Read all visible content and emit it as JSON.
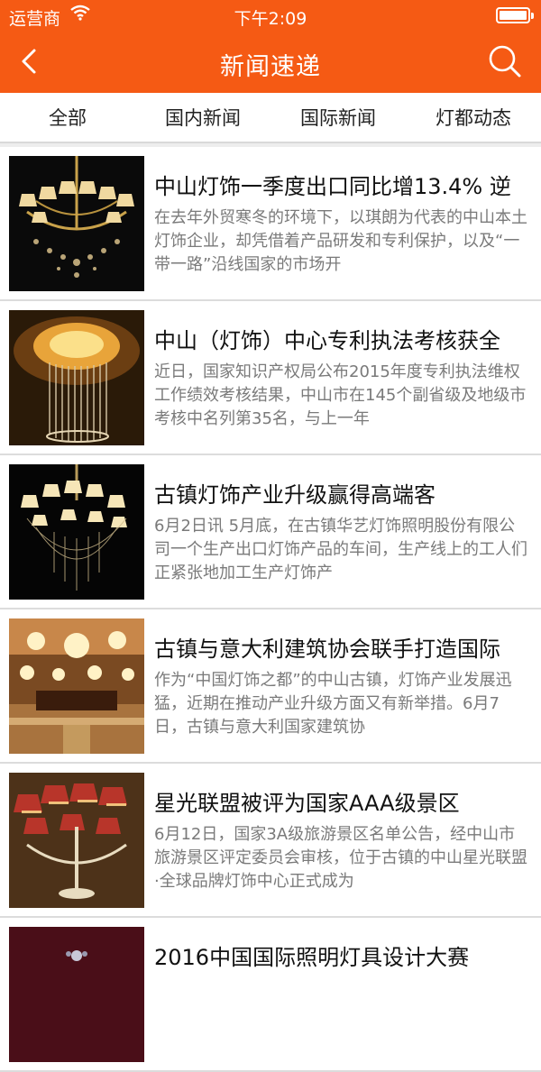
{
  "status_bar": {
    "carrier": "运营商",
    "time": "下午2:09",
    "wifi_icon": "wifi-icon",
    "battery_icon": "battery-icon"
  },
  "nav": {
    "title": "新闻速递",
    "back_icon": "chevron-left-icon",
    "search_icon": "search-icon"
  },
  "tabs": [
    {
      "label": "全部"
    },
    {
      "label": "国内新闻"
    },
    {
      "label": "国际新闻"
    },
    {
      "label": "灯都动态"
    }
  ],
  "colors": {
    "accent": "#f55a14",
    "summary_text": "#7a7a7a",
    "divider": "#dcdcdc"
  },
  "news": [
    {
      "headline": "中山灯饰一季度出口同比增13.4% 逆",
      "summary": "在去年外贸寒冬的环境下，以琪朗为代表的中山本土灯饰企业，却凭借着产品研发和专利保护，以及“一带一路”沿线国家的市场开"
    },
    {
      "headline": "中山（灯饰）中心专利执法考核获全",
      "summary": "近日，国家知识产权局公布2015年度专利执法维权工作绩效考核结果，中山市在145个副省级及地级市考核中名列第35名，与上一年"
    },
    {
      "headline": "古镇灯饰产业升级赢得高端客",
      "summary": "6月2日讯 5月底，在古镇华艺灯饰照明股份有限公司一个生产出口灯饰产品的车间，生产线上的工人们正紧张地加工生产灯饰产"
    },
    {
      "headline": "古镇与意大利建筑协会联手打造国际",
      "summary": "作为“中国灯饰之都”的中山古镇，灯饰产业发展迅猛，近期在推动产业升级方面又有新举措。6月7日，古镇与意大利国家建筑协"
    },
    {
      "headline": "星光联盟被评为国家AAA级景区",
      "summary": "6月12日，国家3A级旅游景区名单公告，经中山市旅游景区评定委员会审核，位于古镇的中山星光联盟·全球品牌灯饰中心正式成为"
    },
    {
      "headline": "2016中国国际照明灯具设计大赛",
      "summary": ""
    }
  ]
}
